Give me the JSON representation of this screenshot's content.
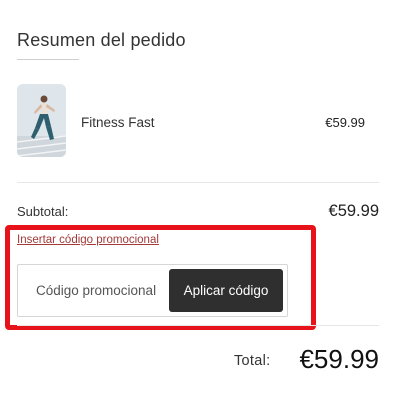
{
  "summary": {
    "title": "Resumen del pedido"
  },
  "product": {
    "name": "Fitness Fast",
    "price": "€59.99",
    "image_icon": "product-photo-runner"
  },
  "subtotal": {
    "label": "Subtotal:",
    "value": "€59.99"
  },
  "promo": {
    "link_label": "Insertar código promocional",
    "input_placeholder": "Código promocional",
    "input_value": "",
    "apply_label": "Aplicar código"
  },
  "total": {
    "label": "Total:",
    "value": "€59.99"
  },
  "colors": {
    "accent_link": "#a23a3a",
    "button_bg": "#2f2f2f",
    "highlight_border": "#e8131a"
  }
}
